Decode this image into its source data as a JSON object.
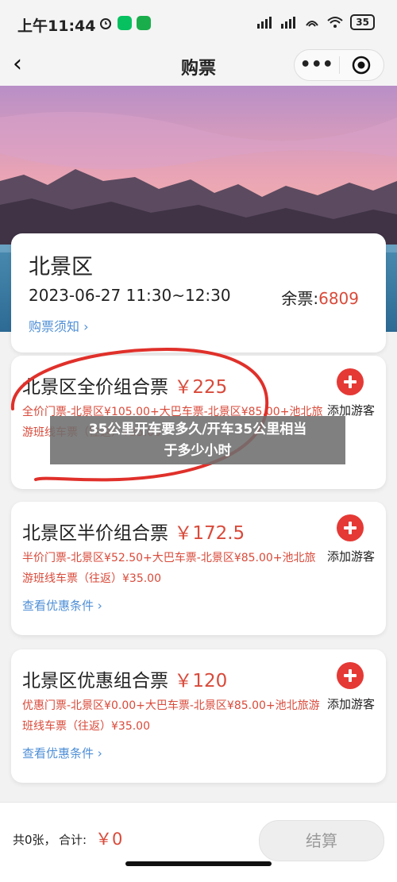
{
  "status": {
    "time": "上午11:44",
    "battery": "35"
  },
  "nav": {
    "back": "‹",
    "title": "购票",
    "more": "•••"
  },
  "info": {
    "name": "北景区",
    "date": "2023-06-27 11:30~12:30",
    "remain_label": "余票:",
    "remain_value": "6809",
    "notice": "购票须知 ›"
  },
  "tickets": [
    {
      "title": "北景区全价组合票",
      "price": "￥225",
      "desc": "全价门票-北景区¥105.00+大巴车票-北景区¥85.00+池北旅游班线车票（往返）¥35.00",
      "add": "添加游客",
      "terms": ""
    },
    {
      "title": "北景区半价组合票",
      "price": "￥172.5",
      "desc": "半价门票-北景区¥52.50+大巴车票-北景区¥85.00+池北旅游班线车票（往返）¥35.00",
      "add": "添加游客",
      "terms": "查看优惠条件 ›"
    },
    {
      "title": "北景区优惠组合票",
      "price": "￥120",
      "desc": "优惠门票-北景区¥0.00+大巴车票-北景区¥85.00+池北旅游班线车票（往返）¥35.00",
      "add": "添加游客",
      "terms": "查看优惠条件 ›"
    }
  ],
  "overlay": {
    "line1": "35公里开车要多久/开车35公里相当",
    "line2": "于多少小时"
  },
  "bottom": {
    "count": "共0张，",
    "total_label": "合计:",
    "amount": "￥0",
    "checkout": "结算"
  },
  "colors": {
    "accent_red": "#e53935",
    "price_red": "#d94a3a",
    "link_blue": "#4f8fd6"
  }
}
